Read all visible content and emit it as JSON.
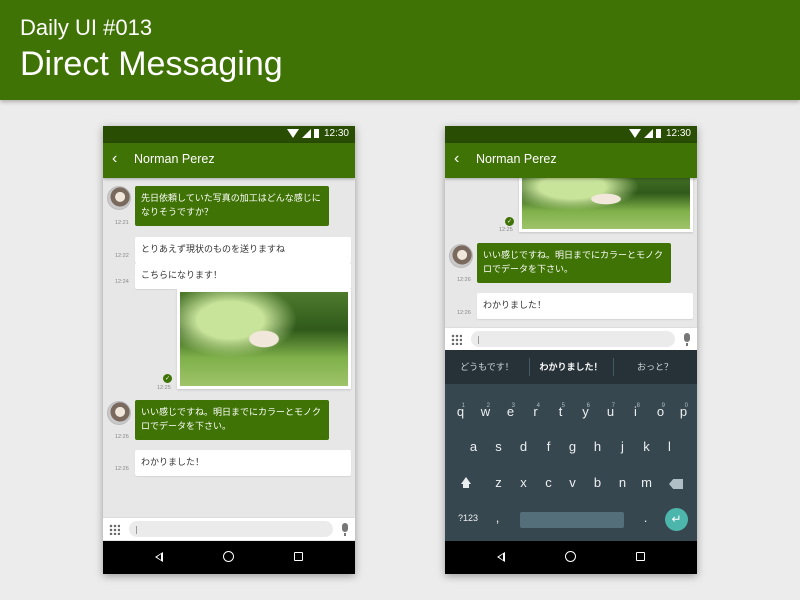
{
  "header": {
    "subtitle": "Daily UI #013",
    "title": "Direct Messaging"
  },
  "phone1": {
    "status": {
      "time": "12:30"
    },
    "appbar": {
      "back": "‹",
      "contact": "Norman Perez"
    },
    "messages": [
      {
        "text": "先日依頼していた写真の加工はどんな感じになりそうですか？",
        "time": "12:21"
      },
      {
        "text": "とりあえず現状のものを送りますね",
        "time": "12:22"
      },
      {
        "text": "こちらになります！",
        "time": "12:24"
      },
      {
        "time": "12:25"
      },
      {
        "text": "いい感じですね。明日までにカラーとモノクロでデータを下さい。",
        "time": "12:26"
      },
      {
        "text": "わかりました！",
        "time": "12:26"
      }
    ],
    "input": {
      "placeholder": "|"
    }
  },
  "phone2": {
    "status": {
      "time": "12:30"
    },
    "appbar": {
      "back": "‹",
      "contact": "Norman Perez"
    },
    "messages": [
      {
        "time": "12:25"
      },
      {
        "text": "いい感じですね。明日までにカラーとモノクロでデータを下さい。",
        "time": "12:26"
      },
      {
        "text": "わかりました！",
        "time": "12:26"
      }
    ],
    "input": {
      "placeholder": "|"
    },
    "suggestions": [
      "どうもです！",
      "わかりました！",
      "おっと？"
    ],
    "keyboard": {
      "row1": [
        "q",
        "w",
        "e",
        "r",
        "t",
        "y",
        "u",
        "i",
        "o",
        "p"
      ],
      "row1_hints": [
        "1",
        "2",
        "3",
        "4",
        "5",
        "6",
        "7",
        "8",
        "9",
        "0"
      ],
      "row2": [
        "a",
        "s",
        "d",
        "f",
        "g",
        "h",
        "j",
        "k",
        "l"
      ],
      "row3": [
        "z",
        "x",
        "c",
        "v",
        "b",
        "n",
        "m"
      ],
      "symbols": "?123",
      "comma": ",",
      "period": ".",
      "enter": "↵"
    }
  },
  "colors": {
    "brand": "#3f7305",
    "status_bar": "#294d03",
    "keyboard_bg": "#37474f",
    "enter_key": "#4db6ac"
  }
}
